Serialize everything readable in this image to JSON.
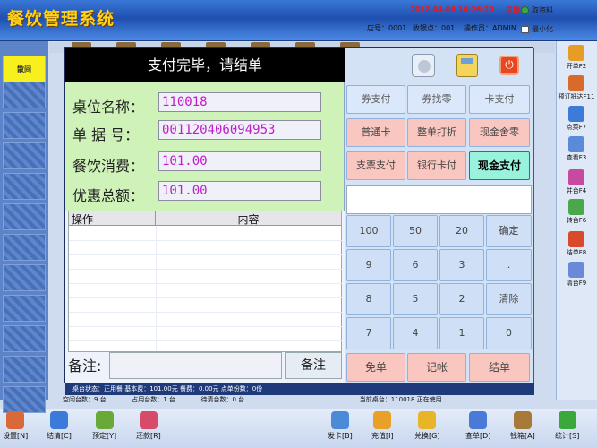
{
  "app": {
    "title": "餐饮管理系统",
    "datetime": "2012-04-06  10:26:20",
    "weekday": "星期五",
    "switch_label": "取资料",
    "minimize_label": "最小化",
    "store_label": "店号：0001",
    "cashier_label": "收银点：001",
    "operator_label": "操作员：ADMIN"
  },
  "left_tabs": [
    {
      "label": "散间"
    },
    {
      "label": ""
    },
    {
      "label": ""
    },
    {
      "label": ""
    },
    {
      "label": ""
    },
    {
      "label": ""
    },
    {
      "label": ""
    },
    {
      "label": ""
    },
    {
      "label": ""
    },
    {
      "label": ""
    },
    {
      "label": ""
    },
    {
      "label": ""
    }
  ],
  "right_actions": [
    {
      "label": "开单F2",
      "icon": "open-order-icon",
      "color": "#e89c28"
    },
    {
      "label": "预订抵达F11",
      "icon": "reservation-icon",
      "color": "#d86a2a"
    },
    {
      "label": "点菜F7",
      "icon": "order-dish-icon",
      "color": "#3c7cd8"
    },
    {
      "label": "查看F3",
      "icon": "view-icon",
      "color": "#5a8ad8"
    },
    {
      "label": "并台F4",
      "icon": "merge-table-icon",
      "color": "#c84aa0"
    },
    {
      "label": "转台F6",
      "icon": "transfer-table-icon",
      "color": "#4aa84a"
    },
    {
      "label": "结单F8",
      "icon": "checkout-icon",
      "color": "#d84a2a"
    },
    {
      "label": "清台F9",
      "icon": "clear-table-icon",
      "color": "#6a8ad8"
    }
  ],
  "dialog": {
    "title": "支付完毕，请结单",
    "fields": [
      {
        "label": "桌位名称：",
        "value": "110018"
      },
      {
        "label": "单 据 号：",
        "value": "001120406094953"
      },
      {
        "label": "餐饮消费：",
        "value": "101.00"
      },
      {
        "label": "优惠总额：",
        "value": "101.00"
      }
    ],
    "table_headers": {
      "op": "操作",
      "content": "内容"
    },
    "note_label": "备注:",
    "note_button": "备注",
    "pay_buttons": {
      "r1": [
        "券支付",
        "券找零",
        "卡支付"
      ],
      "r2": [
        "普通卡",
        "整单打折",
        "现金舍零"
      ],
      "r3": [
        "支票支付",
        "银行卡付",
        "现金支付"
      ]
    },
    "keypad": [
      [
        "100",
        "50",
        "20",
        "确定"
      ],
      [
        "9",
        "6",
        "3",
        "."
      ],
      [
        "8",
        "5",
        "2",
        "清除"
      ],
      [
        "7",
        "4",
        "1",
        "0"
      ]
    ],
    "actions": [
      "免单",
      "记帐",
      "结单"
    ],
    "status": "桌台状态：正用餐    基本费：101.00元    餐费：0.00元    点单份数：0份"
  },
  "status_line": {
    "empty": "空闲台数：9 台",
    "occupied": "占用台数：1 台",
    "pending": "待清台数：0 台",
    "current": "当前桌台：110018    正在使用"
  },
  "bottom_tools": [
    {
      "label": "设置[N]",
      "icon": "settings-icon",
      "color": "#d86a3a"
    },
    {
      "label": "结清[C]",
      "icon": "settle-icon",
      "color": "#3a7ad8"
    },
    {
      "label": "预定[Y]",
      "icon": "reserve-icon",
      "color": "#6aa83a"
    },
    {
      "label": "还款[R]",
      "icon": "repay-icon",
      "color": "#d84a6a"
    },
    {
      "label": "发卡[B]",
      "icon": "issue-card-icon",
      "color": "#4a8ad8"
    },
    {
      "label": "充值[I]",
      "icon": "recharge-icon",
      "color": "#e8a028"
    },
    {
      "label": "兑换[G]",
      "icon": "exchange-icon",
      "color": "#e8b428"
    },
    {
      "label": "查单[D]",
      "icon": "query-order-icon",
      "color": "#4a7ad8"
    },
    {
      "label": "钱箱[A]",
      "icon": "cash-box-icon",
      "color": "#a87a3a"
    },
    {
      "label": "统计[S]",
      "icon": "statistics-icon",
      "color": "#3aa83a"
    }
  ]
}
